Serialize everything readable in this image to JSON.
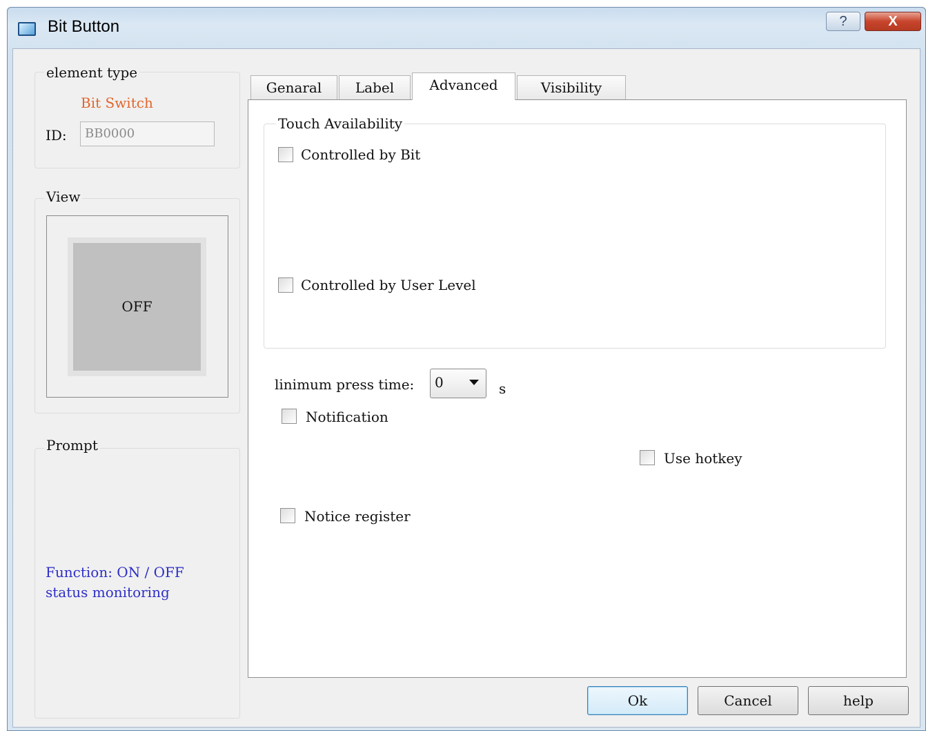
{
  "window": {
    "title": "Bit Button",
    "help_label": "?",
    "close_label": "X"
  },
  "element_type": {
    "group_title": "element type",
    "type_name": "Bit Switch",
    "id_label": "ID:",
    "id_value": "BB0000"
  },
  "view": {
    "group_title": "View",
    "button_text": "OFF"
  },
  "prompt": {
    "group_title": "Prompt",
    "text": "Function: ON / OFF\nstatus monitoring"
  },
  "tabs": [
    {
      "label": "Genaral",
      "active": false
    },
    {
      "label": "Label",
      "active": false
    },
    {
      "label": "Advanced",
      "active": true
    },
    {
      "label": "Visibility",
      "active": false
    }
  ],
  "advanced": {
    "touch_group_title": "Touch Availability",
    "controlled_by_bit": {
      "label": "Controlled by Bit",
      "checked": false
    },
    "controlled_by_user_level": {
      "label": "Controlled by User Level",
      "checked": false
    },
    "min_press_label": "linimum press time:",
    "min_press_value": "0",
    "min_press_unit": "s",
    "notification": {
      "label": "Notification",
      "checked": false
    },
    "use_hotkey": {
      "label": "Use hotkey",
      "checked": false
    },
    "notice_register": {
      "label": "Notice register",
      "checked": false
    }
  },
  "buttons": {
    "ok": "Ok",
    "cancel": "Cancel",
    "help": "help"
  }
}
